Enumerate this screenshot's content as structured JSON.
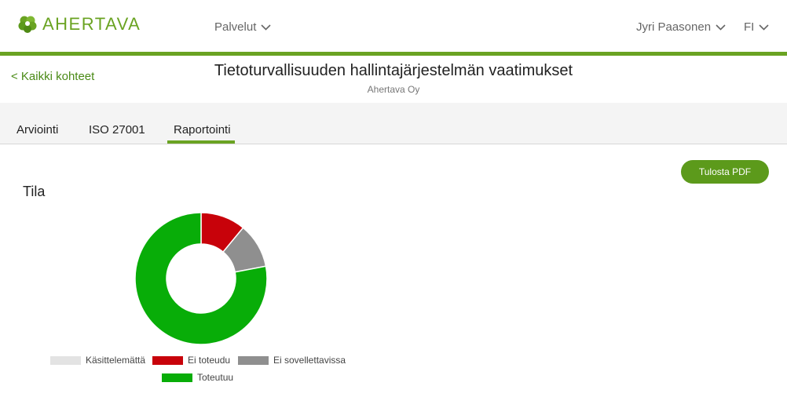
{
  "header": {
    "logo_text": "AHERTAVA",
    "services_label": "Palvelut",
    "user_label": "Jyri Paasonen",
    "lang_label": "FI"
  },
  "titlebar": {
    "back_label": "< Kaikki kohteet",
    "title": "Tietoturvallisuuden hallintajärjestelmän vaatimukset",
    "subtitle": "Ahertava Oy"
  },
  "tabs": [
    {
      "label": "Arviointi",
      "active": false
    },
    {
      "label": "ISO 27001",
      "active": false
    },
    {
      "label": "Raportointi",
      "active": true
    }
  ],
  "content": {
    "print_label": "Tulosta PDF",
    "section_title": "Tila"
  },
  "chart_data": {
    "type": "pie",
    "subtype": "donut",
    "title": "",
    "series": [
      {
        "name": "Käsittelemättä",
        "value": 0,
        "color": "#e3e3e3"
      },
      {
        "name": "Ei toteudu",
        "value": 11,
        "color": "#c8020a"
      },
      {
        "name": "Ei sovellettavissa",
        "value": 11,
        "color": "#8f8f8f"
      },
      {
        "name": "Toteutuu",
        "value": 78,
        "color": "#08ad08"
      }
    ],
    "legend_position": "bottom"
  },
  "colors": {
    "brand": "#6aa322",
    "button": "#5c9a1b"
  }
}
